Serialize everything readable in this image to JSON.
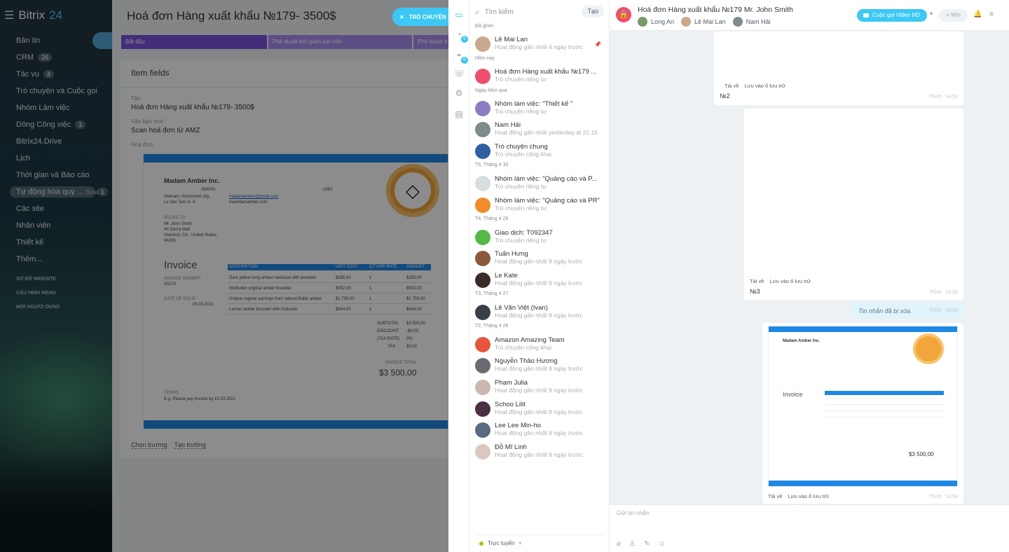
{
  "sidebar": {
    "logo_name": "Bitrix",
    "logo_num": "24",
    "items": [
      {
        "label": "Bản tin",
        "count": ""
      },
      {
        "label": "CRM",
        "count": "26"
      },
      {
        "label": "Tác vụ",
        "count": "4"
      },
      {
        "label": "Trò chuyện và Cuộc gọi",
        "count": ""
      },
      {
        "label": "Nhóm Làm việc",
        "count": ""
      },
      {
        "label": "Dòng Công việc",
        "count": "1"
      },
      {
        "label": "Bitrix24.Drive",
        "count": ""
      },
      {
        "label": "Lịch",
        "count": ""
      },
      {
        "label": "Thời gian và Báo cáo",
        "count": ""
      },
      {
        "label": "Tự động hóa quy ...",
        "count": "1",
        "beta": "Beta"
      },
      {
        "label": "Các site",
        "count": ""
      },
      {
        "label": "Nhân viên",
        "count": ""
      },
      {
        "label": "Thiết kế",
        "count": ""
      },
      {
        "label": "Thêm...",
        "count": ""
      }
    ],
    "sections": [
      "SƠ ĐỒ WEBSITE",
      "CẤU HÌNH MENU",
      "MỜI NGƯỜI DÙNG"
    ]
  },
  "crm": {
    "title": "Hoá đơn Hàng xuất khẩu №179- 3500$",
    "chat_button": "TRÒ CHUYỆN",
    "stages": [
      "Bắt đầu",
      "Phê duyệt bởi giám sát viên",
      "Phê duyệt b"
    ],
    "card_title": "Item fields",
    "fields": {
      "name_label": "Tên",
      "name_value": "Hoá đơn Hàng xuất khẩu №179- 3500$",
      "text_label": "Văn bản mới",
      "text_value": "Scan hoá đơn từ AMZ",
      "invoice_label": "Hoá đơn"
    },
    "invoice": {
      "company": "Madam Amber Inc.",
      "zip": "354000",
      "phone": "-1962",
      "addr1": "Vietnam, Hochiminh city,",
      "addr2": "Le Van Tam st. 8",
      "email": "madamamber@gmail.com",
      "site": "mamdamamber.com",
      "billed_to": "BILLED TO",
      "billed_name": "Mr. John Smith",
      "billed_street": "40 Sierra Mall",
      "billed_city": "Stanford, CA , United States",
      "billed_zip": "94305",
      "heading": "Invoice",
      "num_label": "INVOICE NUMBER",
      "num": "00179",
      "date_label": "DATE OF ISSUE",
      "date": "05.03.2021",
      "cols": [
        "DESCRIPTION",
        "UNIT COST",
        "QTY/HR RATE",
        "AMOUNT"
      ],
      "rows": [
        [
          "Dark yellow long amber necklace with pendant",
          "$295,00",
          "1",
          "$295,00"
        ],
        [
          "Multicolor original amber bracelet",
          "$902,00",
          "1",
          "$902,00"
        ],
        [
          "Unique cognac earrings from natural Baltic amber",
          "$1 759,00",
          "1",
          "$1 759,00"
        ],
        [
          "Lemon amber bracelet with inclusion",
          "$544,00",
          "1",
          "$544,00"
        ]
      ],
      "subtotal_label": "SUBTOTAL",
      "subtotal": "$3 500,00",
      "discount_label": "DISCOUNT",
      "discount": "-$0,00",
      "taxrate_label": "(TAX RATE)",
      "taxrate": "0%",
      "tax_label": "TAX",
      "tax": "$0,00",
      "total_label": "INVOICE TOTAL",
      "total": "$3 500,00",
      "terms_label": "TERMS",
      "terms": "E.g. Please pay invoice by 15.03.2021"
    },
    "links": [
      "Chọn trường",
      "Tạo trường"
    ]
  },
  "strip": {
    "badge1": "5",
    "badge2": "6"
  },
  "recent": {
    "search_placeholder": "Tìm kiếm",
    "create_button": "Tạo",
    "groups": [
      "Đã ghim",
      "Hôm nay",
      "Ngày hôm qua",
      "T6, Tháng 4 30",
      "T4, Tháng 4 28",
      "T3, Tháng 4 27",
      "T2, Tháng 4 26"
    ],
    "chats": [
      {
        "name": "Lê Mai Lan",
        "status": "Hoạt động gần nhất 4 ngày trước",
        "color": "#c9a88e"
      },
      {
        "name": "Hoá đơn Hàng xuất khẩu №179 ...",
        "status": "Trò chuyện riêng tư",
        "color": "#ef4f6c"
      },
      {
        "name": "Nhóm làm việc: \"Thiết kế \"",
        "status": "Trò chuyện riêng tư",
        "color": "#8e7cc3"
      },
      {
        "name": "Nam Hải",
        "status": "Hoạt động gần nhất yesterday at 21:15",
        "color": "#7c8c8a"
      },
      {
        "name": "Trò chuyện chung",
        "status": "Trò chuyện công khai",
        "color": "#2e5fa3"
      },
      {
        "name": "Nhóm làm việc: \"Quảng cáo và P...",
        "status": "Trò chuyện riêng tư",
        "color": "#d8dde0"
      },
      {
        "name": "Nhóm làm việc: \"Quảng cáo và PR\"",
        "status": "Trò chuyện riêng tư",
        "color": "#f28b2a"
      },
      {
        "name": "Giao dịch: T092347",
        "status": "Trò chuyện riêng tư",
        "color": "#55b948"
      },
      {
        "name": "Tuấn Hưng",
        "status": "Hoạt động gần nhất 9 ngày trước",
        "color": "#8a5a3a"
      },
      {
        "name": "Le Kate",
        "status": "Hoạt động gần nhất 9 ngày trước",
        "color": "#3a2a2a"
      },
      {
        "name": "Lê Văn Việt (Ivan)",
        "status": "Hoạt động gần nhất 8 ngày trước",
        "color": "#3a3f4a"
      },
      {
        "name": "Amazon Amazing Team",
        "status": "Trò chuyện công khai",
        "color": "#e8553a"
      },
      {
        "name": "Nguyễn Thảo Hương",
        "status": "Hoạt động gần nhất 9 ngày trước",
        "color": "#6a6a70"
      },
      {
        "name": "Phạm Julia",
        "status": "Hoạt động gần nhất 9 ngày trước",
        "color": "#c8b8b0"
      },
      {
        "name": "Schoo Lilit",
        "status": "Hoạt động gần nhất 9 ngày trước",
        "color": "#4a3040"
      },
      {
        "name": "Lee Lee Min-ho",
        "status": "Hoạt động gần nhất 9 ngày trước",
        "color": "#5a6a80"
      },
      {
        "name": "Đỗ Mĩ Linh",
        "status": "Hoạt động gần nhất 9 ngày trước",
        "color": "#d8c8c0"
      }
    ],
    "online_status": "Trực tuyến"
  },
  "chat": {
    "title": "Hoá đơn Hàng xuất khẩu №179 Mr. John Smith",
    "members": [
      "Long An",
      "Lê Mai Lan",
      "Nam Hải"
    ],
    "video_button": "Cuộc gọi Video HD",
    "more_button": "Mời",
    "msg1": {
      "num": "№2",
      "download": "Tải về",
      "save": "Lưu vào ổ lưu trữ",
      "like": "Thích",
      "time": "14:53"
    },
    "msg2": {
      "num": "№3",
      "download": "Tải về",
      "save": "Lưu vào ổ lưu trữ",
      "like": "Thích",
      "time": "14:53"
    },
    "deleted": {
      "text": "Tin nhắn đã bị xóa.",
      "like": "Thích",
      "time": "14:53"
    },
    "msg3": {
      "download": "Tải về",
      "save": "Lưu vào ổ lưu trữ",
      "like": "Thích",
      "time": "14:54"
    },
    "input_placeholder": "Gửi tin nhắn"
  }
}
